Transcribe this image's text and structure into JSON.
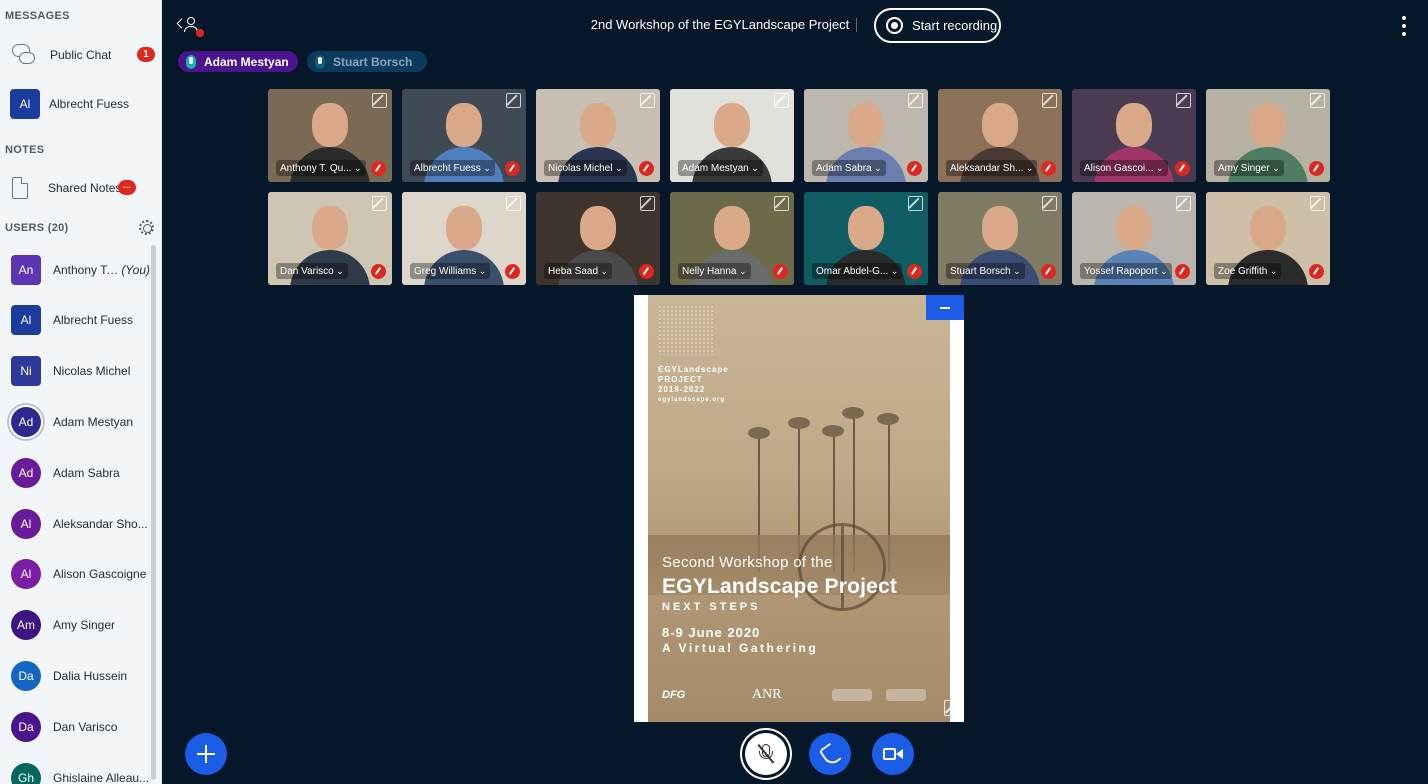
{
  "sidebar": {
    "messages_title": "MESSAGES",
    "public_chat_label": "Public Chat",
    "public_chat_unread": "1",
    "private_chat": {
      "initials": "Al",
      "name": "Albrecht Fuess"
    },
    "notes_title": "NOTES",
    "shared_notes_label": "Shared Notes",
    "shared_notes_badge": "···",
    "users_title": "USERS (20)",
    "users": [
      {
        "initials": "An",
        "name": "Anthony T. ...",
        "you": "(You)",
        "color": "#5c35b5",
        "status": "muted",
        "presenter": true,
        "moderator": false
      },
      {
        "initials": "Al",
        "name": "Albrecht Fuess",
        "you": "",
        "color": "#1b3c9f",
        "status": "muted",
        "presenter": true,
        "moderator": false
      },
      {
        "initials": "Ni",
        "name": "Nicolas Michel",
        "you": "",
        "color": "#2e3a9a",
        "status": "muted",
        "presenter": true,
        "moderator": false
      },
      {
        "initials": "Ad",
        "name": "Adam Mestyan",
        "you": "",
        "color": "#2d2a8f",
        "status": "talking",
        "presenter": false,
        "moderator": true
      },
      {
        "initials": "Ad",
        "name": "Adam Sabra",
        "you": "",
        "color": "#6a1b9a",
        "status": "muted",
        "presenter": false,
        "moderator": false
      },
      {
        "initials": "Al",
        "name": "Aleksandar Sho...",
        "you": "",
        "color": "#6a1b9a",
        "status": "muted",
        "presenter": false,
        "moderator": false
      },
      {
        "initials": "Al",
        "name": "Alison Gascoigne",
        "you": "",
        "color": "#7b1fa2",
        "status": "muted",
        "presenter": false,
        "moderator": false
      },
      {
        "initials": "Am",
        "name": "Amy Singer",
        "you": "",
        "color": "#3d1482",
        "status": "muted",
        "presenter": false,
        "moderator": false
      },
      {
        "initials": "Da",
        "name": "Dalia Hussein",
        "you": "",
        "color": "#1565c0",
        "status": "muted",
        "presenter": false,
        "moderator": false
      },
      {
        "initials": "Da",
        "name": "Dan Varisco",
        "you": "",
        "color": "#4a148c",
        "status": "muted",
        "presenter": false,
        "moderator": false
      },
      {
        "initials": "Gh",
        "name": "Ghislaine Alleau...",
        "you": "",
        "color": "#00695c",
        "status": "muted",
        "presenter": false,
        "moderator": false
      }
    ]
  },
  "header": {
    "meeting_title": "2nd Workshop of the EGYLandscape Project",
    "record_label": "Start recording",
    "talkers": [
      {
        "name": "Adam Mestyan",
        "active": true
      },
      {
        "name": "Stuart Borsch",
        "active": false
      }
    ]
  },
  "videos": [
    {
      "name": "Anthony T. Qu...",
      "bg": "#7a6a55",
      "body": "#2b2b2b"
    },
    {
      "name": "Albrecht Fuess",
      "bg": "#3f4a55",
      "body": "#4f7fbf"
    },
    {
      "name": "Nicolas Michel",
      "bg": "#c9bfb3",
      "body": "#2a3550"
    },
    {
      "name": "Adam Mestyan",
      "bg": "#e2e0da",
      "body": "#3a3a3a"
    },
    {
      "name": "Adam Sabra",
      "bg": "#bdb7ae",
      "body": "#6a7fb0"
    },
    {
      "name": "Aleksandar Sh...",
      "bg": "#8a7157",
      "body": "#4a3a33"
    },
    {
      "name": "Alison Gascoi...",
      "bg": "#4a3b52",
      "body": "#a03668"
    },
    {
      "name": "Amy Singer",
      "bg": "#b8b2a4",
      "body": "#4e7d62"
    },
    {
      "name": "Dan Varisco",
      "bg": "#cfc5b3",
      "body": "#2f3a4a"
    },
    {
      "name": "Greg Williams",
      "bg": "#ddd6ca",
      "body": "#3a4f6c"
    },
    {
      "name": "Heba Saad",
      "bg": "#3d342d",
      "body": "#4a4a4a"
    },
    {
      "name": "Nelly Hanna",
      "bg": "#6d6a4a",
      "body": "#6b6b6b"
    },
    {
      "name": "Omar Abdel-G...",
      "bg": "#0f5c63",
      "body": "#2a2a2a"
    },
    {
      "name": "Stuart Borsch",
      "bg": "#7f7a63",
      "body": "#3b4d75"
    },
    {
      "name": "Yossef Rapoport",
      "bg": "#bab6ad",
      "body": "#5b83b8"
    },
    {
      "name": "Zoe Griffith",
      "bg": "#cdbfa8",
      "body": "#2b2b2b"
    }
  ],
  "slide": {
    "logo_line1": "EGYLandscape",
    "logo_line2": "PROJECT",
    "logo_line3": "2019-2022",
    "logo_line4": "egylandscape.org",
    "line1": "Second Workshop of the",
    "line2": "EGYLandscape Project",
    "line3": "NEXT STEPS",
    "line4": "8-9 June 2020",
    "line5": "A Virtual Gathering",
    "sponsor1": "DFG",
    "sponsor2": "ANR"
  },
  "controls": {
    "actions_icon": "plus-icon",
    "mic_icon": "mic-muted-icon",
    "phone_icon": "phone-icon",
    "camera_icon": "camera-icon",
    "accent": "#1b5de6"
  }
}
